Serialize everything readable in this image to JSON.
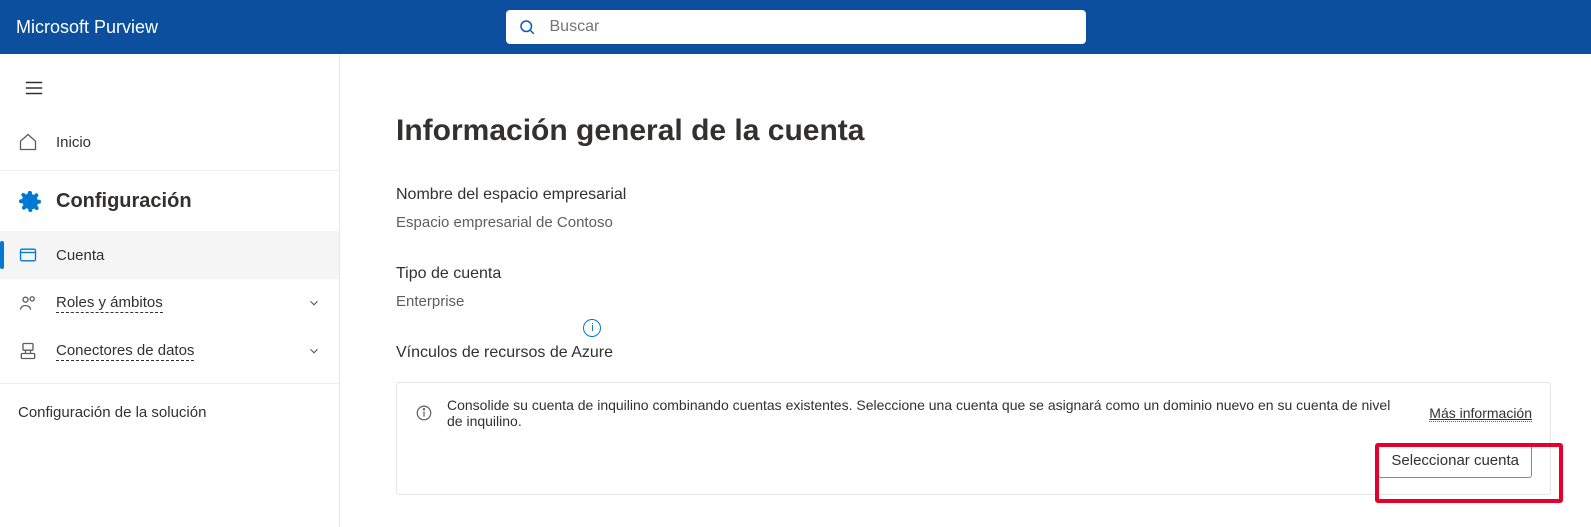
{
  "header": {
    "title": "Microsoft Purview"
  },
  "search": {
    "placeholder": "Buscar"
  },
  "sidebar": {
    "home": "Inicio",
    "settings": "Configuración",
    "account": "Cuenta",
    "roles": "Roles y ámbitos",
    "connectors": "Conectores de datos",
    "solution": "Configuración de la solución"
  },
  "main": {
    "title": "Información general de la cuenta",
    "tenant_label": "Nombre del espacio empresarial",
    "tenant_value": "Espacio empresarial de Contoso",
    "account_type_label": "Tipo de cuenta",
    "account_type_value": "Enterprise",
    "azure_label": "Vínculos de recursos de Azure",
    "banner_text": "Consolide su cuenta de inquilino combinando cuentas existentes. Seleccione una cuenta que se asignará como un dominio nuevo en su cuenta de nivel de inquilino.",
    "banner_link": "Más información",
    "select_button": "Seleccionar cuenta"
  }
}
